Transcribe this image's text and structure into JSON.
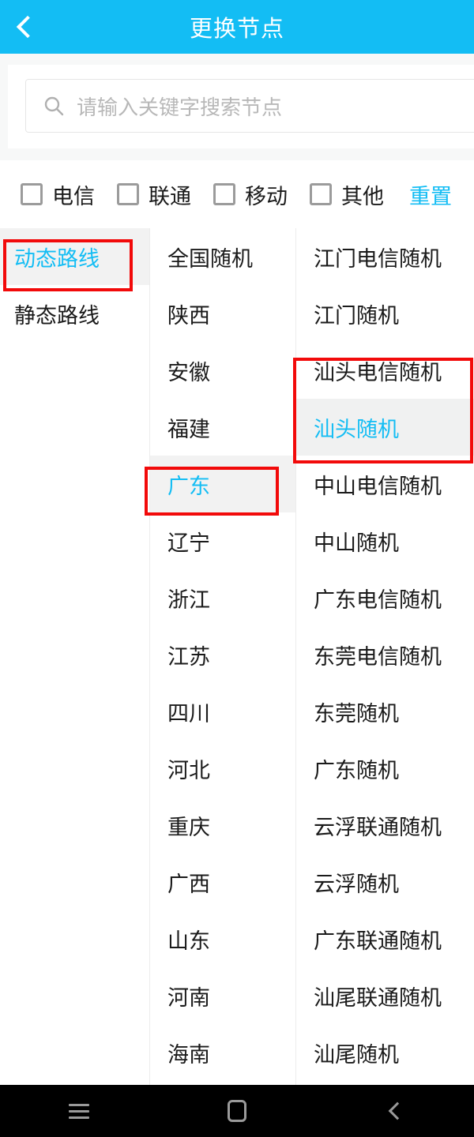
{
  "colors": {
    "header_bg": "#13bdf4",
    "accent": "#13bdf4",
    "annotation": "#f20a0a",
    "selected_row_bg": "#f2f2f2",
    "text": "#1a1a1a",
    "placeholder": "#b8b8b8"
  },
  "header": {
    "title": "更换节点",
    "back_icon": "chevron-left-icon"
  },
  "search": {
    "icon": "search-icon",
    "value": "",
    "placeholder": "请输入关键字搜索节点"
  },
  "filters": {
    "items": [
      {
        "label": "电信",
        "checked": false
      },
      {
        "label": "联通",
        "checked": false
      },
      {
        "label": "移动",
        "checked": false
      },
      {
        "label": "其他",
        "checked": false
      }
    ],
    "reset_label": "重置"
  },
  "panes": {
    "route_types": {
      "items": [
        {
          "label": "动态路线",
          "selected": true
        },
        {
          "label": "静态路线",
          "selected": false
        }
      ]
    },
    "regions": {
      "items": [
        {
          "label": "全国随机",
          "selected": false
        },
        {
          "label": "陕西",
          "selected": false
        },
        {
          "label": "安徽",
          "selected": false
        },
        {
          "label": "福建",
          "selected": false
        },
        {
          "label": "广东",
          "selected": true
        },
        {
          "label": "辽宁",
          "selected": false
        },
        {
          "label": "浙江",
          "selected": false
        },
        {
          "label": "江苏",
          "selected": false
        },
        {
          "label": "四川",
          "selected": false
        },
        {
          "label": "河北",
          "selected": false
        },
        {
          "label": "重庆",
          "selected": false
        },
        {
          "label": "广西",
          "selected": false
        },
        {
          "label": "山东",
          "selected": false
        },
        {
          "label": "河南",
          "selected": false
        },
        {
          "label": "海南",
          "selected": false
        }
      ]
    },
    "nodes": {
      "items": [
        {
          "label": "江门电信随机",
          "selected": false
        },
        {
          "label": "江门随机",
          "selected": false
        },
        {
          "label": "汕头电信随机",
          "selected": false
        },
        {
          "label": "汕头随机",
          "selected": true
        },
        {
          "label": "中山电信随机",
          "selected": false
        },
        {
          "label": "中山随机",
          "selected": false
        },
        {
          "label": "广东电信随机",
          "selected": false
        },
        {
          "label": "东莞电信随机",
          "selected": false
        },
        {
          "label": "东莞随机",
          "selected": false
        },
        {
          "label": "广东随机",
          "selected": false
        },
        {
          "label": "云浮联通随机",
          "selected": false
        },
        {
          "label": "云浮随机",
          "selected": false
        },
        {
          "label": "广东联通随机",
          "selected": false
        },
        {
          "label": "汕尾联通随机",
          "selected": false
        },
        {
          "label": "汕尾随机",
          "selected": false
        }
      ]
    }
  },
  "annotations": [
    {
      "name": "annot-dynamic",
      "target": "动态路线"
    },
    {
      "name": "annot-guangdong",
      "target": "广东"
    },
    {
      "name": "annot-shantou",
      "target": "汕头电信随机 / 汕头随机"
    }
  ],
  "navbar": {
    "items": [
      {
        "icon": "menu-icon",
        "name": "recents-button"
      },
      {
        "icon": "home-icon",
        "name": "home-button"
      },
      {
        "icon": "chevron-left-icon",
        "name": "back-button"
      }
    ]
  }
}
